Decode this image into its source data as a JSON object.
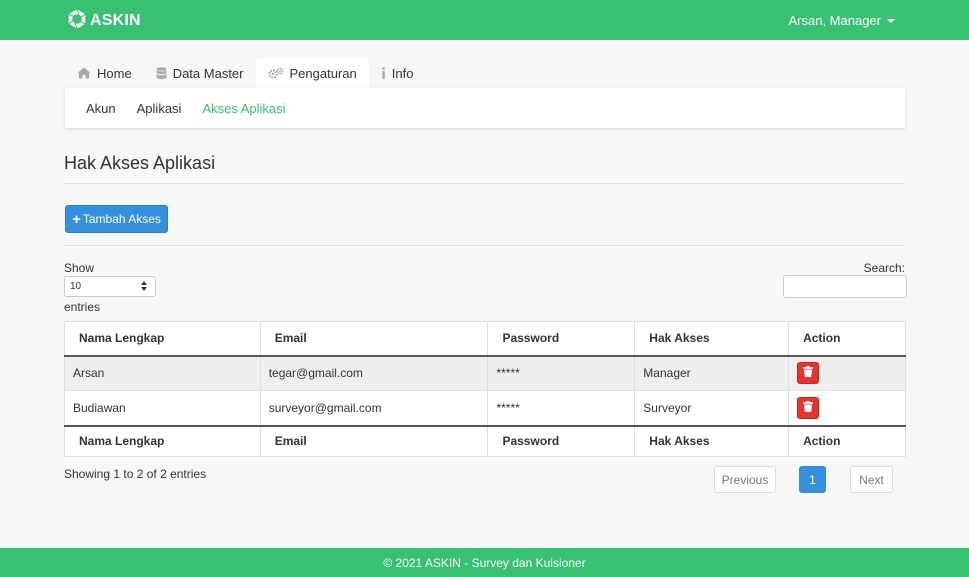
{
  "brand": {
    "name": "ASKIN",
    "color": "#38c172",
    "icon": "logo-ring-icon"
  },
  "user_menu": {
    "label": "Arsan, Manager",
    "icon": "caret-down-icon"
  },
  "nav": {
    "tabs": [
      {
        "label": "Home",
        "icon": "home-icon",
        "active": false
      },
      {
        "label": "Data Master",
        "icon": "database-icon",
        "active": false
      },
      {
        "label": "Pengaturan",
        "icon": "gears-icon",
        "active": true
      },
      {
        "label": "Info",
        "icon": "info-icon",
        "active": false
      }
    ]
  },
  "subnav": {
    "items": [
      {
        "label": "Akun",
        "active": false
      },
      {
        "label": "Aplikasi",
        "active": false
      },
      {
        "label": "Akses Aplikasi",
        "active": true
      }
    ]
  },
  "page": {
    "title": "Hak Akses Aplikasi"
  },
  "toolbar": {
    "add_label": "Tambah Akses",
    "add_icon": "plus-icon"
  },
  "table_controls": {
    "show_label": "Show",
    "length_value": "10",
    "entries_label": "entries",
    "search_label": "Search:",
    "search_value": ""
  },
  "table": {
    "headers": [
      "Nama Lengkap",
      "Email",
      "Password",
      "Hak Akses",
      "Action"
    ],
    "rows": [
      {
        "name": "Arsan",
        "email": "tegar@gmail.com",
        "password": "*****",
        "role": "Manager"
      },
      {
        "name": "Budiawan",
        "email": "surveyor@gmail.com",
        "password": "*****",
        "role": "Surveyor"
      }
    ],
    "action_icon": "trash-icon"
  },
  "pagination": {
    "info": "Showing 1 to 2 of 2 entries",
    "previous": "Previous",
    "current_page": "1",
    "next": "Next"
  },
  "footer": {
    "text": "© 2021 ASKIN - Survey dan Kuisioner"
  },
  "colors": {
    "primary": "#3490dc",
    "danger": "#e3342f",
    "success": "#38c172"
  }
}
